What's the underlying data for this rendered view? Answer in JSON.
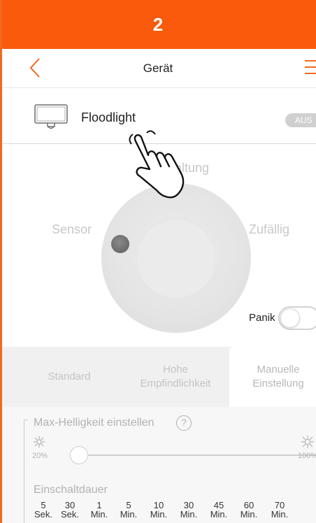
{
  "step": {
    "number": "2"
  },
  "nav": {
    "title": "Gerät",
    "back_icon": "chevron-left-icon",
    "menu_icon": "menu-icon"
  },
  "device": {
    "name": "Floodlight",
    "status": "AUS",
    "icon": "floodlight-icon"
  },
  "modes": {
    "top_partial": "altung",
    "left": "Sensor",
    "right": "Zufällig",
    "panic_label": "Panik",
    "panic_on": false
  },
  "tabs": [
    {
      "label": "Standard",
      "active": false
    },
    {
      "label": "Hohe\nEmpfindlichkeit",
      "active": false
    },
    {
      "label": "Manuelle\nEinstellung",
      "active": true
    }
  ],
  "brightness": {
    "title": "Max-Helligkeit einstellen",
    "min_label": "20%",
    "max_label": "100%",
    "value_fraction": 0
  },
  "duration": {
    "title": "Einschaltdauer",
    "options": [
      {
        "value": "5",
        "unit": "Sek."
      },
      {
        "value": "30",
        "unit": "Sek."
      },
      {
        "value": "1",
        "unit": "Min."
      },
      {
        "value": "5",
        "unit": "Min."
      },
      {
        "value": "10",
        "unit": "Min."
      },
      {
        "value": "30",
        "unit": "Min."
      },
      {
        "value": "45",
        "unit": "Min."
      },
      {
        "value": "60",
        "unit": "Min."
      },
      {
        "value": "70",
        "unit": "Min."
      }
    ]
  },
  "colors": {
    "accent": "#f26a1b",
    "step_bar": "#f95a0b"
  }
}
